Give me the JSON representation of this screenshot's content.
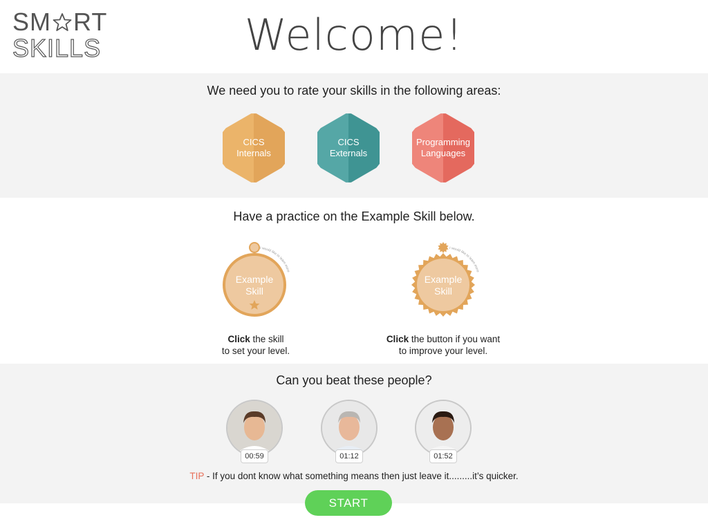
{
  "logo": {
    "line1_left": "SM",
    "line1_right": "RT",
    "line2": "SKILLS"
  },
  "header": {
    "title": "Welcome!"
  },
  "rate_section": {
    "heading": "We need you to rate your skills in the following areas:",
    "areas": [
      {
        "line1": "CICS",
        "line2": "Internals",
        "color_light": "#ebb46a",
        "color_dark": "#e2a55a"
      },
      {
        "line1": "CICS",
        "line2": "Externals",
        "color_light": "#55a7a6",
        "color_dark": "#3f9493"
      },
      {
        "line1": "Programming",
        "line2": "Languages",
        "color_light": "#ee857a",
        "color_dark": "#e4695e"
      }
    ]
  },
  "practice_section": {
    "heading": "Have a practice on the Example Skill below.",
    "skill_line1": "Example",
    "skill_line2": "Skill",
    "arc_text": "I would like to learn more",
    "left_instruction": {
      "bold": "Click",
      "rest": " the skill",
      "line2": "to set your level."
    },
    "right_instruction": {
      "bold": "Click",
      "rest": " the button if you want",
      "line2": "to improve your level."
    },
    "colors": {
      "ring": "#e2a55a",
      "fill": "#eec9a0",
      "star": "#e2a55a"
    }
  },
  "people_section": {
    "heading": "Can you beat these people?",
    "people": [
      {
        "time": "00:59",
        "skin": "#e7b894",
        "hair": "#5a3b28",
        "shirt": "#ffffff",
        "bg": "#d9d6d0"
      },
      {
        "time": "01:12",
        "skin": "#e8b89a",
        "hair": "#b9b6b2",
        "shirt": "#e8eef5",
        "bg": "#e8e8e8"
      },
      {
        "time": "01:52",
        "skin": "#a87152",
        "hair": "#2a1a12",
        "shirt": "#f5f5f5",
        "bg": "#ededed"
      }
    ],
    "tip_label": "TIP",
    "tip_text": " - If you dont know what something means then just leave it.........it’s quicker."
  },
  "start_button": {
    "label": "START",
    "color": "#5fd158"
  }
}
